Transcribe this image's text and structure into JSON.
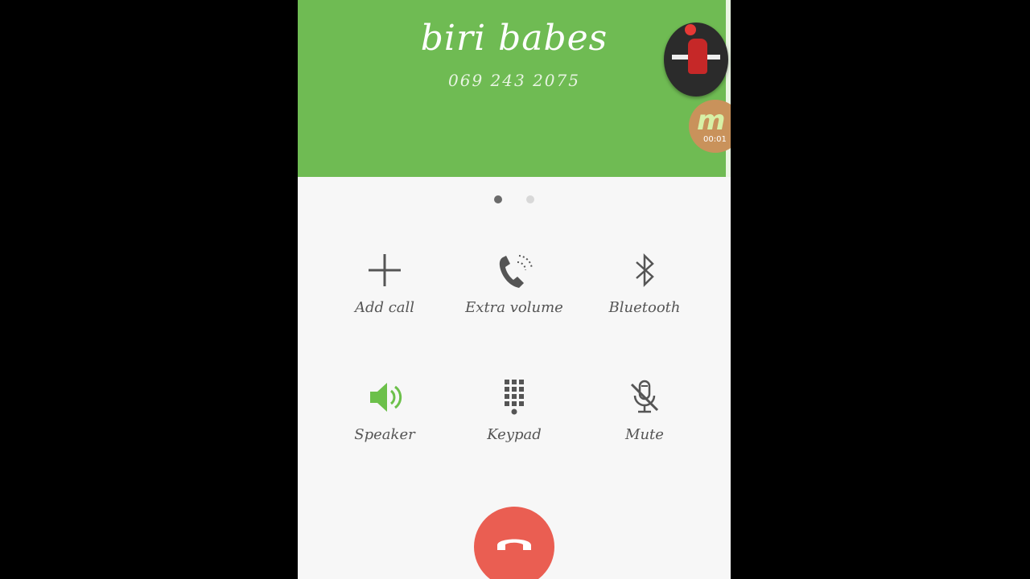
{
  "call": {
    "contact_name": "biri babes",
    "phone_number": "069 243 2075"
  },
  "overlay": {
    "recorder_badge_letter": "m",
    "recorder_timer": "00:01"
  },
  "colors": {
    "header_green": "#6fbb53",
    "speaker_active_green": "#6cc04a",
    "end_call_red": "#ea5e52"
  },
  "actions": [
    {
      "id": "add_call",
      "label": "Add call",
      "icon": "plus-icon"
    },
    {
      "id": "extra_volume",
      "label": "Extra volume",
      "icon": "phone-volume-icon"
    },
    {
      "id": "bluetooth",
      "label": "Bluetooth",
      "icon": "bluetooth-icon"
    },
    {
      "id": "speaker",
      "label": "Speaker",
      "icon": "speaker-icon",
      "active": true
    },
    {
      "id": "keypad",
      "label": "Keypad",
      "icon": "keypad-icon"
    },
    {
      "id": "mute",
      "label": "Mute",
      "icon": "mic-off-icon"
    }
  ],
  "pager": {
    "pages": 2,
    "current": 1
  },
  "end_call": {
    "icon": "end-call-icon"
  }
}
